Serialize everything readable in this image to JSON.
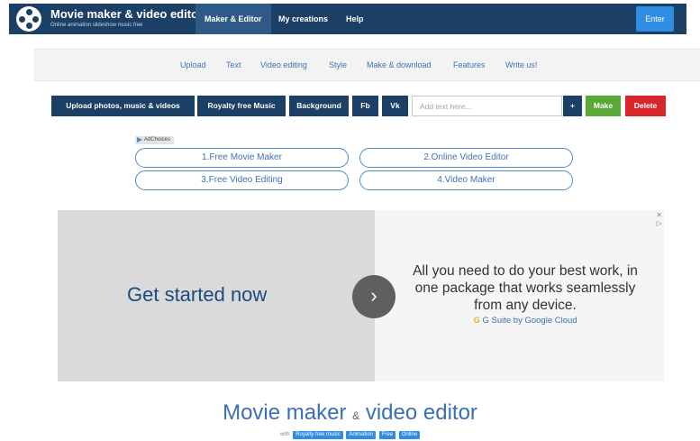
{
  "header": {
    "title": "Movie maker & video editor",
    "subtitle": "Online animation slideshow music free",
    "tabs": [
      {
        "label": "Maker & Editor",
        "active": true
      },
      {
        "label": "My creations",
        "active": false
      },
      {
        "label": "Help",
        "active": false
      }
    ],
    "enter_label": "Enter"
  },
  "subnav": {
    "items": [
      "Upload",
      "Text",
      "Video editing",
      "Style",
      "Make & download",
      "Features",
      "Write us!"
    ]
  },
  "toolbar": {
    "upload_label": "Upload photos, music & videos",
    "music_label": "Royalty free Music",
    "background_label": "Background",
    "fb_label": "Fb",
    "vk_label": "Vk",
    "text_placeholder": "Add text here...",
    "add_label": "+",
    "make_label": "Make",
    "delete_label": "Delete"
  },
  "ad_links": {
    "adchoices_label": "AdChoices",
    "links": [
      "1.Free Movie Maker",
      "2.Online Video Editor",
      "3.Free Video Editing",
      "4.Video Maker"
    ]
  },
  "banner_ad": {
    "headline": "Get started now",
    "body": "All you need to do your best work, in one package that works seamlessly from any device.",
    "brand_g": "G",
    "brand": "G Suite by Google Cloud",
    "close_glyph": "✕",
    "info_glyph": "▷"
  },
  "footer_heading": {
    "part1": "Movie maker",
    "amp": "&",
    "part2": "video editor",
    "with_label": "with",
    "tags": [
      "Royalty free music",
      "Animation",
      "Free",
      "Online"
    ]
  },
  "colors": {
    "nav_dark": "#1c3f66",
    "accent_blue": "#2f8de4",
    "make_green": "#5aa835",
    "delete_red": "#d9262d"
  }
}
